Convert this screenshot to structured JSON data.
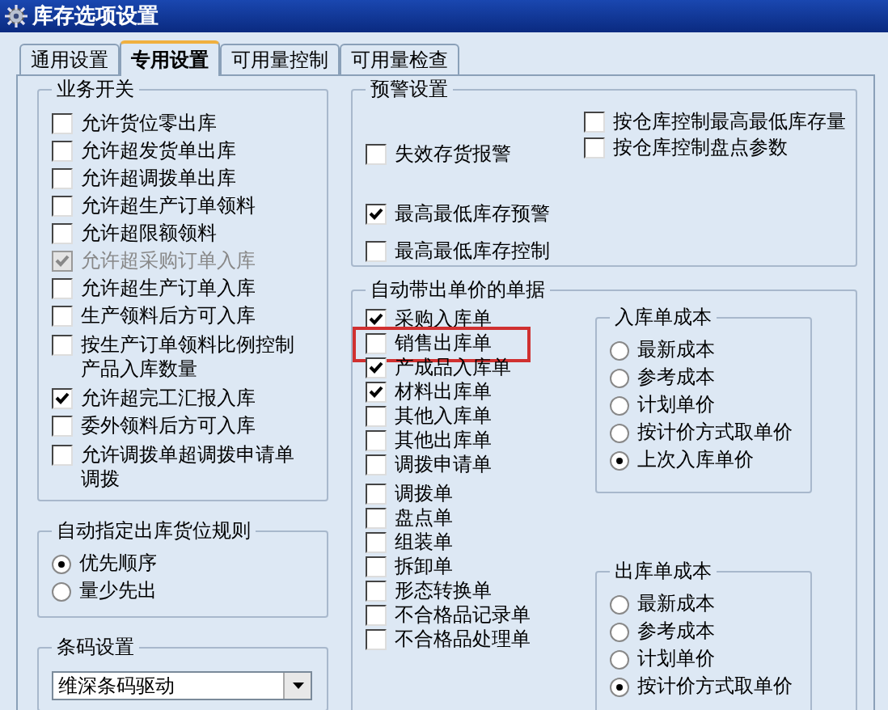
{
  "window": {
    "title": "库存选项设置"
  },
  "tabs": [
    {
      "label": "通用设置",
      "selected": false
    },
    {
      "label": "专用设置",
      "selected": true
    },
    {
      "label": "可用量控制",
      "selected": false
    },
    {
      "label": "可用量检查",
      "selected": false
    }
  ],
  "business_switches": {
    "title": "业务开关",
    "items": [
      {
        "label": "允许货位零出库",
        "checked": false,
        "disabled": false
      },
      {
        "label": "允许超发货单出库",
        "checked": false,
        "disabled": false
      },
      {
        "label": "允许超调拨单出库",
        "checked": false,
        "disabled": false
      },
      {
        "label": "允许超生产订单领料",
        "checked": false,
        "disabled": false
      },
      {
        "label": "允许超限额领料",
        "checked": false,
        "disabled": false
      },
      {
        "label": "允许超采购订单入库",
        "checked": true,
        "disabled": true
      },
      {
        "label": "允许超生产订单入库",
        "checked": false,
        "disabled": false
      },
      {
        "label": "生产领料后方可入库",
        "checked": false,
        "disabled": false
      },
      {
        "label": "按生产订单领料比例控制产品入库数量",
        "checked": false,
        "disabled": false
      },
      {
        "label": "允许超完工汇报入库",
        "checked": true,
        "disabled": false
      },
      {
        "label": "委外领料后方可入库",
        "checked": false,
        "disabled": false
      },
      {
        "label": "允许调拨单超调拨申请单调拨",
        "checked": false,
        "disabled": false
      }
    ]
  },
  "location_rule": {
    "title": "自动指定出库货位规则",
    "options": [
      {
        "label": "优先顺序",
        "selected": true
      },
      {
        "label": "量少先出",
        "selected": false
      }
    ]
  },
  "barcode": {
    "title": "条码设置",
    "value": "维深条码驱动"
  },
  "alarm_settings": {
    "title": "预警设置",
    "columns": [
      {
        "items": [
          {
            "label": "失效存货报警",
            "checked": false
          },
          {
            "label": "最高最低库存预警",
            "checked": true
          },
          {
            "label": "最高最低库存控制",
            "checked": false
          }
        ]
      },
      {
        "items": [
          {
            "label": "按仓库控制最高最低库存量",
            "checked": false
          },
          {
            "label": "按仓库控制盘点参数",
            "checked": false
          }
        ]
      }
    ]
  },
  "auto_price_docs": {
    "title": "自动带出单价的单据",
    "items": [
      {
        "label": "采购入库单",
        "checked": true,
        "highlighted": false
      },
      {
        "label": "销售出库单",
        "checked": false,
        "highlighted": true
      },
      {
        "label": "产成品入库单",
        "checked": true,
        "highlighted": false
      },
      {
        "label": "材料出库单",
        "checked": true,
        "highlighted": false
      },
      {
        "label": "其他入库单",
        "checked": false,
        "highlighted": false
      },
      {
        "label": "其他出库单",
        "checked": false,
        "highlighted": false
      },
      {
        "label": "调拨申请单",
        "checked": false,
        "highlighted": false
      },
      {
        "label": "调拨单",
        "checked": false,
        "highlighted": false
      },
      {
        "label": "盘点单",
        "checked": false,
        "highlighted": false
      },
      {
        "label": "组装单",
        "checked": false,
        "highlighted": false
      },
      {
        "label": "拆卸单",
        "checked": false,
        "highlighted": false
      },
      {
        "label": "形态转换单",
        "checked": false,
        "highlighted": false
      },
      {
        "label": "不合格品记录单",
        "checked": false,
        "highlighted": false
      },
      {
        "label": "不合格品处理单",
        "checked": false,
        "highlighted": false
      }
    ]
  },
  "inbound_cost": {
    "title": "入库单成本",
    "options": [
      {
        "label": "最新成本",
        "selected": false
      },
      {
        "label": "参考成本",
        "selected": false
      },
      {
        "label": "计划单价",
        "selected": false
      },
      {
        "label": "按计价方式取单价",
        "selected": false
      },
      {
        "label": "上次入库单价",
        "selected": true
      }
    ]
  },
  "outbound_cost": {
    "title": "出库单成本",
    "options": [
      {
        "label": "最新成本",
        "selected": false
      },
      {
        "label": "参考成本",
        "selected": false
      },
      {
        "label": "计划单价",
        "selected": false
      },
      {
        "label": "按计价方式取单价",
        "selected": true
      }
    ]
  }
}
